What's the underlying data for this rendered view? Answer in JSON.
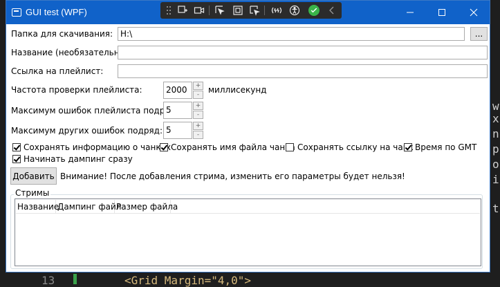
{
  "background": {
    "right_chars": [
      "w",
      "x",
      "n",
      "p",
      "o",
      "i",
      "t"
    ],
    "bottom_line_number": "13",
    "bottom_code": "<Grid Margin=\"4,0\">"
  },
  "window": {
    "title": "GUI test (WPF)",
    "titlebar_color": "#1062c9"
  },
  "form": {
    "download_folder_label": "Папка для скачивания:",
    "download_folder_value": "H:\\",
    "browse_button": "...",
    "name_label": "Название (необязательно):",
    "name_value": "",
    "playlist_url_label": "Ссылка на плейлист:",
    "playlist_url_value": "",
    "check_interval_label": "Частота проверки плейлиста:",
    "check_interval_value": "2000",
    "check_interval_unit": "миллисекунд",
    "max_playlist_errors_label": "Максимум ошибок плейлиста подряд:",
    "max_playlist_errors_value": "5",
    "max_other_errors_label": "Максимум других ошибок подряд:",
    "max_other_errors_value": "5",
    "spin_up": "+",
    "spin_down": "-"
  },
  "options": {
    "save_chunk_info": {
      "label": "Сохранять информацию о чанках",
      "checked": true
    },
    "save_chunk_filename": {
      "label": "Сохранять имя файла чанка",
      "checked": true
    },
    "save_chunk_url": {
      "label": "Сохранять ссылку на чанк",
      "checked": false
    },
    "gmt_time": {
      "label": "Время по GMT",
      "checked": true
    },
    "start_dumping": {
      "label": "Начинать дампинг сразу",
      "checked": true
    }
  },
  "add": {
    "button": "Добавить",
    "warning": "Внимание! После добавления стрима, изменить его параметры будет нельзя!"
  },
  "streams": {
    "group_title": "Стримы",
    "columns": [
      "Название",
      "Дампинг файл",
      "Размер файла"
    ]
  }
}
